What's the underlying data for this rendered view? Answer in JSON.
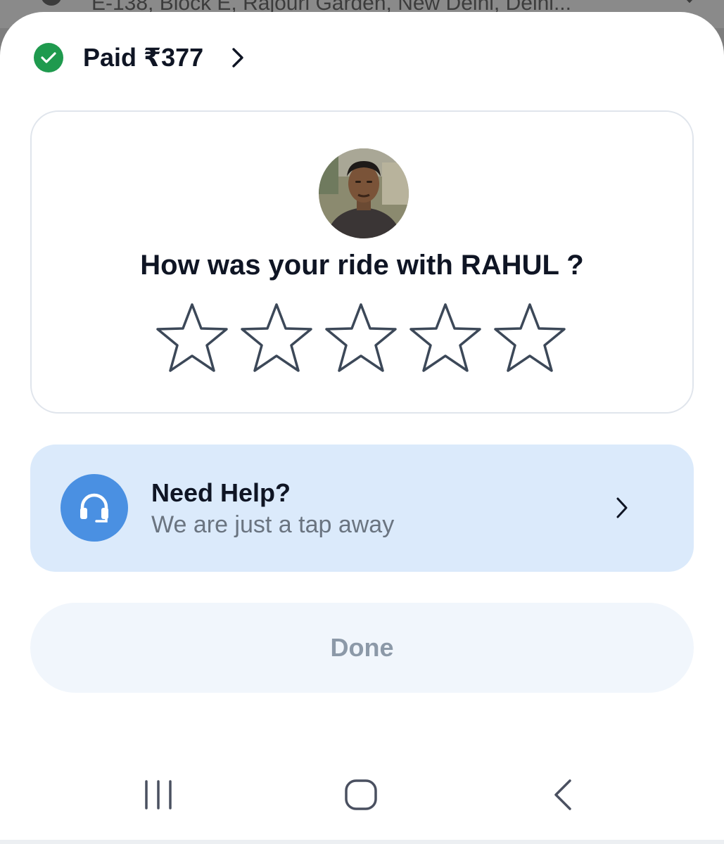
{
  "background": {
    "address": "E-138, Block E, Rajouri Garden, New Delhi, Delhi..."
  },
  "payment": {
    "status_label": "Paid ₹377",
    "icon": "check-circle-icon"
  },
  "rating": {
    "question": "How was your ride with RAHUL ?",
    "max_stars": 5,
    "selected_stars": 0
  },
  "help": {
    "title": "Need Help?",
    "subtitle": "We are just a tap away",
    "icon": "headset-icon"
  },
  "actions": {
    "done_label": "Done"
  },
  "navigation": {
    "recent_apps": "recent-apps-icon",
    "home": "home-icon",
    "back": "back-icon"
  },
  "colors": {
    "success_green": "#1f9a4e",
    "help_background": "#dbeafb",
    "help_icon_blue": "#4a90e2",
    "done_background": "#f1f6fc",
    "done_text": "#8c99a8",
    "star_outline": "#3c4858"
  }
}
